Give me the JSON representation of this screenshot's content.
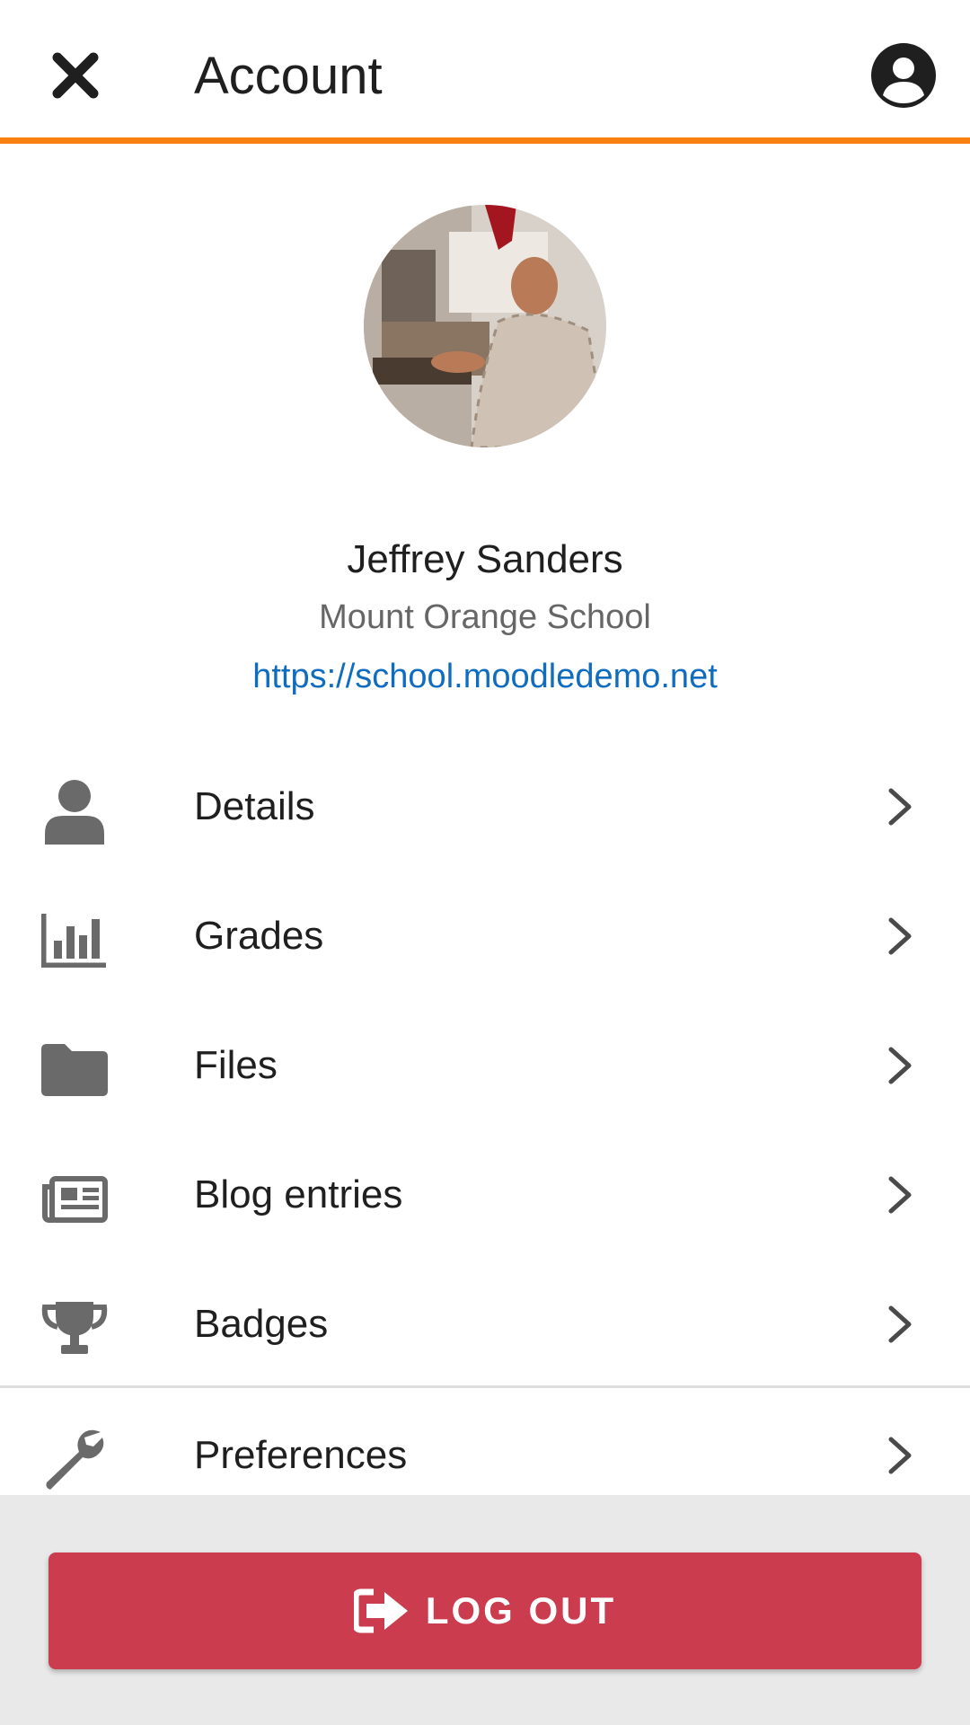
{
  "header": {
    "title": "Account",
    "close_icon": "close-icon",
    "user_icon": "user-circle-icon",
    "accent": "#f98012"
  },
  "profile": {
    "name": "Jeffrey Sanders",
    "site_name": "Mount Orange School",
    "site_url": "https://school.moodledemo.net"
  },
  "menu": {
    "items": [
      {
        "label": "Details",
        "icon": "user-icon"
      },
      {
        "label": "Grades",
        "icon": "bar-chart-icon"
      },
      {
        "label": "Files",
        "icon": "folder-icon"
      },
      {
        "label": "Blog entries",
        "icon": "newspaper-icon"
      },
      {
        "label": "Badges",
        "icon": "trophy-icon"
      },
      {
        "label": "Preferences",
        "icon": "wrench-icon"
      }
    ]
  },
  "footer": {
    "logout_label": "LOG OUT",
    "logout_icon": "sign-out-icon",
    "logout_color": "#ca3c4e"
  }
}
